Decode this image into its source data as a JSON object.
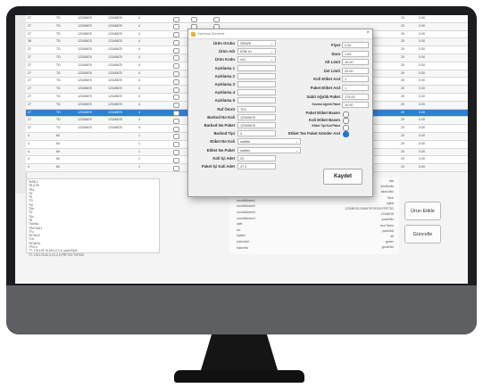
{
  "grid": {
    "rows": [
      {
        "c": [
          "27",
          "TD",
          "12345678",
          "12345678",
          "4"
        ],
        "r": [
          "20",
          "0.00"
        ]
      },
      {
        "c": [
          "27",
          "TD",
          "12345678",
          "12345678",
          "4"
        ],
        "r": [
          "20",
          "0.00"
        ]
      },
      {
        "c": [
          "27",
          "TD",
          "12345678",
          "12345678",
          "4"
        ],
        "r": [
          "20",
          "0.00"
        ]
      },
      {
        "c": [
          "38",
          "TD",
          "12345678",
          "12345678",
          "4"
        ],
        "r": [
          "20",
          "0.00"
        ]
      },
      {
        "c": [
          "27",
          "TD",
          "12345678",
          "12345678",
          "4"
        ],
        "r": [
          "20",
          "0.00"
        ]
      },
      {
        "c": [
          "27",
          "TD",
          "12345678",
          "12345678",
          "4"
        ],
        "r": [
          "20",
          "0.00"
        ]
      },
      {
        "c": [
          "27",
          "TD",
          "12345678",
          "12345678",
          "4"
        ],
        "r": [
          "20",
          "0.00"
        ]
      },
      {
        "c": [
          "27",
          "TD",
          "12345678",
          "12345678",
          "4"
        ],
        "r": [
          "20",
          "0.00"
        ]
      },
      {
        "c": [
          "27",
          "TD",
          "12345678",
          "12345678",
          "4"
        ],
        "r": [
          "20",
          "0.00"
        ]
      },
      {
        "c": [
          "27",
          "TD",
          "12345678",
          "12345678",
          "4"
        ],
        "r": [
          "20",
          "0.00"
        ]
      },
      {
        "c": [
          "27",
          "TD",
          "12345678",
          "12345678",
          "4"
        ],
        "r": [
          "20",
          "0.00"
        ]
      },
      {
        "c": [
          "27",
          "TD",
          "12345678",
          "12345678",
          "4"
        ],
        "r": [
          "20",
          "0.00"
        ]
      },
      {
        "c": [
          "27",
          "TD",
          "12345678",
          "12345678",
          "4"
        ],
        "r": [
          "20",
          "0.00"
        ]
      },
      {
        "c": [
          "27",
          "TD",
          "12345678",
          "12345678",
          "4"
        ],
        "r": [
          "20",
          "0.00"
        ]
      },
      {
        "c": [
          "27",
          "TD",
          "12345678",
          "12345678",
          "4"
        ],
        "r": [
          "20",
          "0.00"
        ]
      },
      {
        "c": [
          "4",
          "Mi",
          "",
          "",
          "1"
        ],
        "r": [
          "20",
          "0.00"
        ]
      },
      {
        "c": [
          "4",
          "Mi",
          "",
          "",
          "1"
        ],
        "r": [
          "20",
          "0.00"
        ]
      },
      {
        "c": [
          "4",
          "Mi",
          "",
          "",
          "1"
        ],
        "r": [
          "20",
          "0.00"
        ]
      },
      {
        "c": [
          "4",
          "Mi",
          "",
          "",
          "1"
        ],
        "r": [
          "20",
          "0.00"
        ]
      },
      {
        "c": [
          "4",
          "Mi",
          "",
          "",
          "1"
        ],
        "r": [
          "20",
          "0.00"
        ]
      }
    ]
  },
  "log": {
    "lines": [
      "TeSB,0",
      "TB-0,00",
      "TRa",
      "TN",
      "TE",
      "TFi",
      "TM",
      "TNo",
      "TD",
      "TAs",
      "TB",
      "TMoNa",
      "TReClsA1",
      "TFo",
      "TeClsrv0",
      "TOn",
      "TeClsrA1",
      "TPro,n",
      "TT: 178,192,76,69,0,0,0,0, yaziciTipik",
      "TT: 178,178,40,0,0,0,0,0,PRF7D3 TXF003"
    ]
  },
  "midpanel": {
    "left": [
      "urunAdi",
      "urunKod",
      "grupAdi",
      "urunAltAnme1",
      "urunAltAnme2",
      "urunAltAnme3",
      "urunAltAnme4",
      "adet",
      "ad",
      "toplam",
      "bolumAdi",
      "bolumNo"
    ],
    "right": [
      "tbls",
      "tblsRanks",
      "barkodNo",
      "tAnk",
      "kgfiat",
      "1234567812345678TXF003 PRF7D3",
      "12345678",
      "yukselNo",
      "urunTanim",
      "yaziciAdi",
      "alt",
      "goster",
      "gosterNo"
    ]
  },
  "buttons": {
    "onizle": "Ürün Etikle",
    "guncelle": "Güncelle"
  },
  "dialog": {
    "title": "Yazdırma Önizleme",
    "left": [
      {
        "label": "Ürün Grubu",
        "value": "SEBZE"
      },
      {
        "label": "Ürün Adı",
        "value": "İSİM 01"
      },
      {
        "label": "Ürün Kodu",
        "value": "x01"
      },
      {
        "label": "Açıklama 1",
        "value": ""
      },
      {
        "label": "Açıklama 2",
        "value": ""
      },
      {
        "label": "Açıklama 3",
        "value": ""
      },
      {
        "label": "Açıklama 4",
        "value": ""
      },
      {
        "label": "Açıklama 5",
        "value": ""
      },
      {
        "label": "Raf Ömrü",
        "value": "TD1"
      },
      {
        "label": "Barkod No Kali",
        "value": "12345678"
      },
      {
        "label": "Barkod No Paket",
        "value": "12345678"
      },
      {
        "label": "Barkod Tipi",
        "value": "4"
      },
      {
        "label": "Etiket No Kali",
        "value": "sadfds"
      },
      {
        "label": "Etiket No Paket",
        "value": "sadfds"
      },
      {
        "label": "Koli İçi Adet",
        "value": "20"
      },
      {
        "label": "Paket İçi Kali Adet",
        "value": "47.0"
      }
    ],
    "right": [
      {
        "label": "Fiyat",
        "value": "0.00"
      },
      {
        "label": "Dara",
        "value": "1.00"
      },
      {
        "label": "Alt Limit",
        "value": "10.00"
      },
      {
        "label": "Üst Limit",
        "value": "20.00"
      },
      {
        "label": "Koli Etiket Asıl",
        "value": "1"
      },
      {
        "label": "Paket Etiket Asıl",
        "value": "1"
      },
      {
        "label": "Sabit Ağırlık Paket",
        "value": "175.00"
      },
      {
        "label": "Kontrol Ağırlık Paket",
        "value": "10.00"
      }
    ],
    "checks": [
      {
        "label": "Paket Etiket Basım",
        "checked": false
      },
      {
        "label": "Koli Etiket Basım",
        "checked": false
      },
      {
        "label": "Etiket Tipi Koli Paket",
        "checked": false
      },
      {
        "label": "Etiket Tas Paket Gönder Asıl",
        "checked": true
      }
    ],
    "kaydet": "Kaydet"
  }
}
